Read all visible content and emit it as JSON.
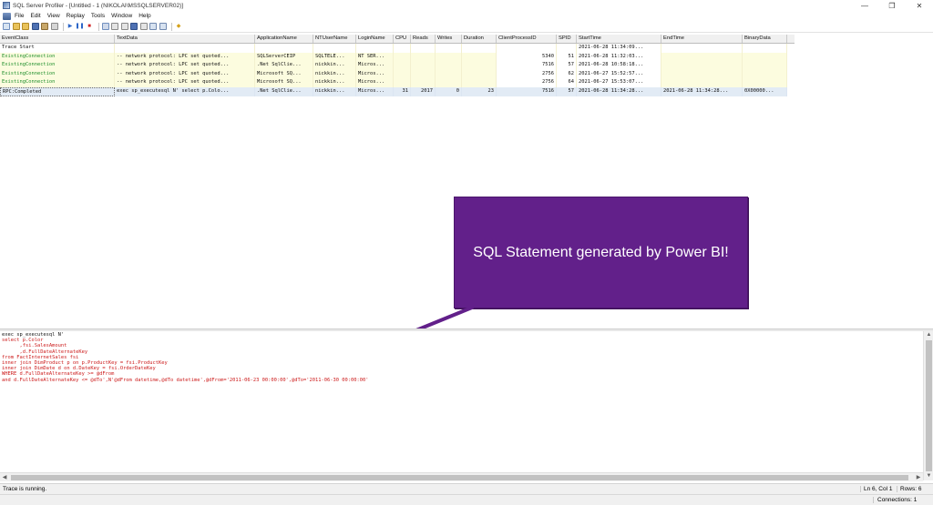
{
  "window": {
    "title": "SQL Server Profiler - [Untitled - 1 (NIKOLAI\\MSSQLSERVER02)]",
    "controls": [
      "—",
      "❐",
      "✕"
    ]
  },
  "menu": [
    "File",
    "Edit",
    "View",
    "Replay",
    "Tools",
    "Window",
    "Help"
  ],
  "grid": {
    "columns": [
      "EventClass",
      "TextData",
      "ApplicationName",
      "NTUserName",
      "LoginName",
      "CPU",
      "Reads",
      "Writes",
      "Duration",
      "ClientProcessID",
      "SPID",
      "StartTime",
      "EndTime",
      "BinaryData"
    ],
    "rows": [
      [
        "Trace Start",
        "",
        "",
        "",
        "",
        "",
        "",
        "",
        "",
        "",
        "",
        "2021-06-28 11:34:09...",
        "",
        ""
      ],
      [
        "ExistingConnection",
        "-- network protocol: LPC  set quoted...",
        "SQLServerCEIP",
        "SQLTELE...",
        "NT SER...",
        "",
        "",
        "",
        "",
        "5340",
        "51",
        "2021-06-28 11:32:03...",
        "",
        ""
      ],
      [
        "ExistingConnection",
        "-- network protocol: LPC  set quoted...",
        ".Net SqlClie...",
        "nickkin...",
        "Micros...",
        "",
        "",
        "",
        "",
        "7516",
        "57",
        "2021-06-28 10:58:18...",
        "",
        ""
      ],
      [
        "ExistingConnection",
        "-- network protocol: LPC  set quoted...",
        "Microsoft SQ...",
        "nickkin...",
        "Micros...",
        "",
        "",
        "",
        "",
        "2756",
        "62",
        "2021-06-27 15:52:57...",
        "",
        ""
      ],
      [
        "ExistingConnection",
        "-- network protocol: LPC  set quoted...",
        "Microsoft SQ...",
        "nickkin...",
        "Micros...",
        "",
        "",
        "",
        "",
        "2756",
        "64",
        "2021-06-27 15:53:07...",
        "",
        ""
      ],
      [
        "RPC:Completed",
        "exec sp_executesql N'  select p.Colo...",
        ".Net SqlClie...",
        "nickkin...",
        "Micros...",
        "31",
        "2017",
        "0",
        "23",
        "7516",
        "57",
        "2021-06-28 11:34:28...",
        "2021-06-28 11:34:28...",
        "0X00000..."
      ]
    ]
  },
  "callout": {
    "text": "SQL Statement generated by Power BI!"
  },
  "sql": {
    "lines": [
      "exec sp_executesql N'",
      "",
      "select p.Color",
      "      ,fsi.SalesAmount",
      "      ,d.FullDateAlternateKey",
      "from FactInternetSales fsi",
      "inner join DimProduct p on p.ProductKey = fsi.ProductKey",
      "inner join DimDate d on d.DateKey = fsi.OrderDateKey",
      "WHERE d.FullDateAlternateKey >= @dFrom",
      "and d.FullDateAlternateKey <= @dTo',N'@dFrom datetime,@dTo datetime',@dFrom='2011-06-23 00:00:00',@dTo='2011-06-30 00:00:00'"
    ]
  },
  "status": {
    "message": "Trace is running.",
    "position": "Ln 6, Col 1",
    "rows": "Rows: 6",
    "connections": "Connections: 1"
  },
  "colors": {
    "callout_bg": "#62208a",
    "sql_text": "#cc1a1a",
    "green_text": "#1f8f2b",
    "row_yellow": "#fcfcdf",
    "row_selected": "#e2ebf5"
  }
}
